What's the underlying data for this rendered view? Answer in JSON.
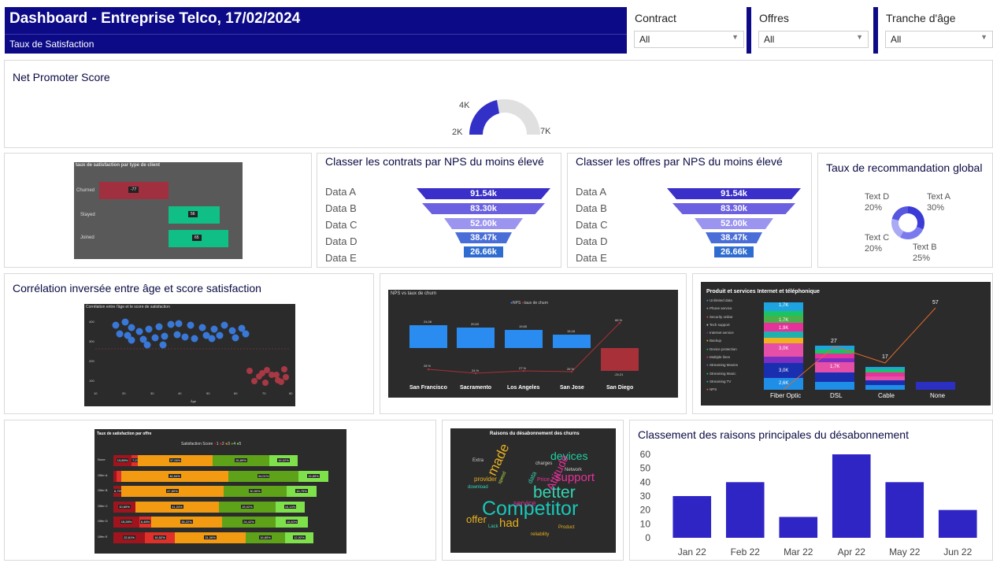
{
  "header": {
    "title": "Dashboard - Entreprise Telco, 17/02/2024",
    "subtitle": "Taux de Satisfaction",
    "color": "#0c0a86"
  },
  "filters": [
    {
      "label": "Contract",
      "value": "All"
    },
    {
      "label": "Offres",
      "value": "All"
    },
    {
      "label": "Tranche d'âge",
      "value": "All"
    }
  ],
  "nps": {
    "title": "Net Promoter Score",
    "min_label": "2K",
    "mid_label": "4K",
    "max_label": "7K"
  },
  "satisfaction_by_type": {
    "title": "taux de satisfaction par type de client",
    "rows": [
      {
        "label": "Churned",
        "value": "-77"
      },
      {
        "label": "Stayed",
        "value": "56"
      },
      {
        "label": "Joined",
        "value": "65"
      }
    ]
  },
  "contracts_funnel": {
    "title": "Classer les contrats par NPS du moins élevé",
    "items": [
      {
        "label": "Data A",
        "value": "91.54k"
      },
      {
        "label": "Data B",
        "value": "83.30k"
      },
      {
        "label": "Data C",
        "value": "52.00k"
      },
      {
        "label": "Data D",
        "value": "38.47k"
      },
      {
        "label": "Data E",
        "value": "26.66k"
      }
    ]
  },
  "offers_funnel": {
    "title": "Classer les offres par NPS du moins élevé",
    "items": [
      {
        "label": "Data A",
        "value": "91.54k"
      },
      {
        "label": "Data B",
        "value": "83.30k"
      },
      {
        "label": "Data C",
        "value": "52.00k"
      },
      {
        "label": "Data D",
        "value": "38.47k"
      },
      {
        "label": "Data E",
        "value": "26.66k"
      }
    ]
  },
  "recommendation": {
    "title": "Taux de recommandation global",
    "slices": [
      {
        "label": "Text A",
        "pct": "30%",
        "value": 30,
        "color": "#3b3bd6"
      },
      {
        "label": "Text B",
        "pct": "25%",
        "value": 25,
        "color": "#7a7aee"
      },
      {
        "label": "Text C",
        "pct": "20%",
        "value": 20,
        "color": "#a9a9f5"
      },
      {
        "label": "Text D",
        "pct": "20%",
        "value": 20,
        "color": "#5757e0"
      }
    ]
  },
  "age_corr": {
    "title": "Corrélation inversée entre âge et score satisfaction",
    "inner_title": "Corrélation entre l'âge et le score de satisfaction",
    "xlabel": "Âge",
    "xticks": [
      "10",
      "20",
      "30",
      "40",
      "50",
      "60",
      "70",
      "80"
    ],
    "yticks": [
      "400",
      "300",
      "200",
      "100"
    ]
  },
  "nps_churn": {
    "title": "NPS vs taux de churn",
    "legend": [
      "NPS",
      "taux de churn"
    ],
    "cities": [
      "San Francisco",
      "Sacramento",
      "Los Angeles",
      "San Jose",
      "San Diego"
    ],
    "nps_labels": [
      "24,08",
      "20,53",
      "19,65",
      "15,18",
      "-24,21"
    ],
    "churn_labels": [
      "28 %",
      "24 %",
      "27 %",
      "26 %",
      "66 %"
    ]
  },
  "products": {
    "title": "Produit et services Internet et téléphonique",
    "legend": [
      "Unlimited data",
      "Phone service",
      "Security online",
      "Tech support",
      "Internet service",
      "Backup",
      "Device protection",
      "Multiple lines",
      "Streaming Movies",
      "Streaming Music",
      "Streaming TV",
      "NPS"
    ],
    "categories": [
      "Fiber Optic",
      "DSL",
      "Cable",
      "None"
    ],
    "value_labels": [
      "1,7K",
      "1,7K",
      "1,9K",
      "3,0K",
      "3,0K",
      "2,6K",
      "1,7K"
    ],
    "line_labels": [
      "27",
      "17",
      "57"
    ]
  },
  "offer_satisfaction": {
    "title": "Taux de satisfaction par offre",
    "legend_title": "Satisfaction Score",
    "legend": [
      "1",
      "2",
      "3",
      "4",
      "5"
    ],
    "rows": [
      {
        "label": "None",
        "cells": [
          "13,85%",
          "7,27%",
          "37,06%",
          "26,89%",
          "16,02%"
        ]
      },
      {
        "label": "Offer A",
        "cells": [
          "",
          "",
          "46,54%",
          "34,01%",
          "15,85%"
        ]
      },
      {
        "label": "Offer B",
        "cells": [
          "6,73%",
          "",
          "47,60%",
          "30,50%",
          "16,75%"
        ]
      },
      {
        "label": "Offer C",
        "cells": [
          "10,60%",
          "",
          "41,03%",
          "28,02%",
          "16,14%"
        ]
      },
      {
        "label": "Offer D",
        "cells": [
          "15,28%",
          "6,48%",
          "35,22%",
          "24,42%",
          "18,60%"
        ]
      },
      {
        "label": "Offer E",
        "cells": [
          "22,61%",
          "16,52%",
          "31,06%",
          "16,85%",
          "12,92%"
        ]
      }
    ]
  },
  "wordcloud": {
    "title": "Raisons du désabonnement des churns",
    "words": [
      "Competitor",
      "better",
      "devices",
      "offer",
      "made",
      "had",
      "support",
      "Attitude",
      "Product",
      "Network",
      "speed",
      "service",
      "provider",
      "Price",
      "data",
      "reliability",
      "Lack",
      "download",
      "charges",
      "Extra"
    ]
  },
  "churn_reasons": {
    "title": "Classement des raisons principales du désabonnement"
  },
  "chart_data": {
    "type": "bar",
    "categories": [
      "Jan 22",
      "Feb 22",
      "Mar 22",
      "Apr 22",
      "May 22",
      "Jun 22"
    ],
    "values": [
      30,
      40,
      15,
      60,
      40,
      20
    ],
    "title": "Classement des raisons principales du désabonnement",
    "xlabel": "",
    "ylabel": "",
    "ylim": [
      0,
      60
    ],
    "yticks": [
      0,
      10,
      20,
      30,
      40,
      50,
      60
    ],
    "color": "#2e25c4",
    "grid": false
  }
}
